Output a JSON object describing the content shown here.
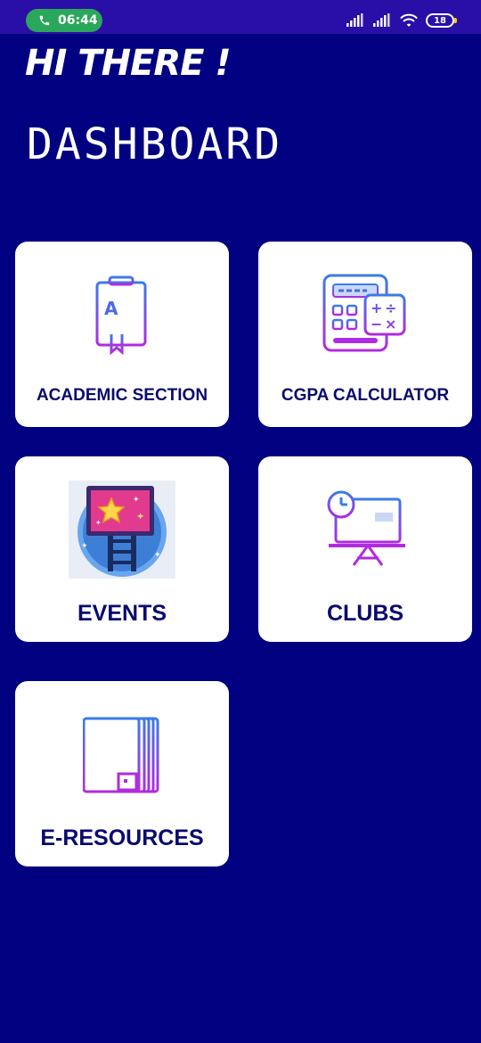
{
  "status_bar": {
    "time": "06:44",
    "battery": "18"
  },
  "header": {
    "greeting": "HI THERE !",
    "title": "DASHBOARD"
  },
  "cards": [
    {
      "label": "ACADEMIC SECTION",
      "icon": "book-icon"
    },
    {
      "label": "CGPA CALCULATOR",
      "icon": "calculator-icon"
    },
    {
      "label": "EVENTS",
      "icon": "events-board-icon"
    },
    {
      "label": "CLUBS",
      "icon": "presentation-icon"
    },
    {
      "label": "E-RESOURCES",
      "icon": "notebook-icon"
    }
  ],
  "colors": {
    "background": "#000080",
    "status_bar": "#2a0ea8",
    "card": "#ffffff",
    "label": "#0a0a6e",
    "call_pill": "#2aa75a"
  }
}
